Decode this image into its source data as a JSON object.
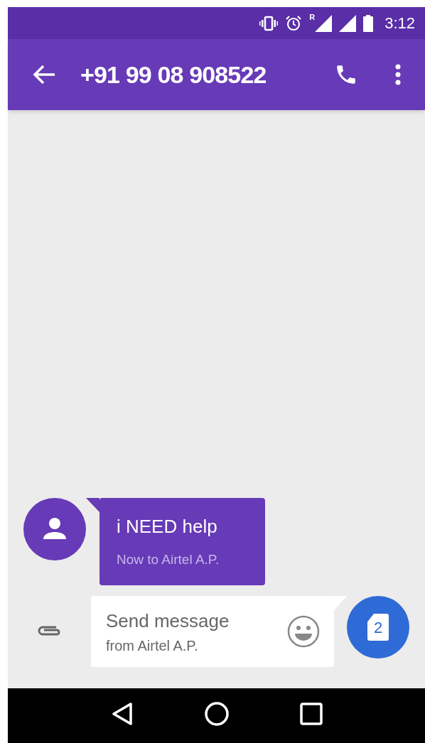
{
  "status_bar": {
    "roaming_label": "R",
    "time": "3:12"
  },
  "app_bar": {
    "title": "+91 99 08 908522"
  },
  "messages": [
    {
      "text": "i NEED help",
      "status": "Now to Airtel A.P."
    }
  ],
  "compose": {
    "placeholder": "Send message",
    "sim_hint": "from Airtel A.P.",
    "sim_button_label": "2"
  }
}
